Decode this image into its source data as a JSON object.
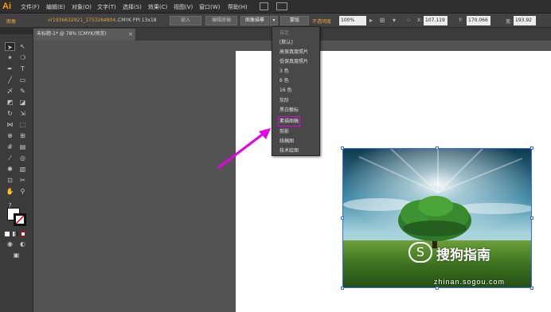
{
  "app": {
    "logo": "Ai"
  },
  "menubar": {
    "items": [
      "文件(F)",
      "编辑(E)",
      "对象(O)",
      "文字(T)",
      "选择(S)",
      "效果(C)",
      "视图(V)",
      "窗口(W)",
      "帮助(H)"
    ]
  },
  "controlbar": {
    "label": "图像",
    "filename": "vr1936632921_1753264804...",
    "colorinfo": "CMYK  PPI  13x18",
    "embed_button": "嵌入",
    "edit_original_button": "编辑原稿",
    "image_trace_button": "图像描摹",
    "mask_button": "蒙版",
    "opacity_label": "不透明度",
    "opacity_value": "100%",
    "x_label": "X:",
    "x_value": "107.119",
    "y_label": "Y:",
    "y_value": "170.066",
    "w_label": "宽:",
    "w_value": "193.92"
  },
  "tab": {
    "title": "未标题-1* @ 78% (CMYK/预览)",
    "close": "×"
  },
  "dropdown": {
    "header": "自定",
    "items": [
      "[默认]",
      "高保真度照片",
      "低保真度照片",
      "3 色",
      "6 色",
      "16 色",
      "灰阶",
      "黑白徽标",
      "素描图稿",
      "剪影",
      "线稿图",
      "技术绘图"
    ],
    "highlighted": "素描图稿"
  },
  "watermark": {
    "logo": "S",
    "text": "搜狗指南",
    "url": "zhinan.sogou.com"
  },
  "colors": {
    "accent_arrow": "#e600e6",
    "selection_blue": "#3b6de0"
  }
}
